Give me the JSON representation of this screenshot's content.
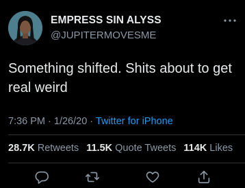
{
  "author": {
    "display_name": "EMPRESS SIN ALYSS",
    "handle": "@JUPITERMOVESME"
  },
  "tweet": {
    "text": "Something shifted. Shits about to get real weird"
  },
  "meta": {
    "time": "7:36 PM",
    "separator1": " · ",
    "date": "1/26/20",
    "separator2": " · ",
    "source": "Twitter for iPhone"
  },
  "stats": {
    "retweets_count": "28.7K",
    "retweets_label": "Retweets",
    "quotes_count": "11.5K",
    "quotes_label": "Quote Tweets",
    "likes_count": "114K",
    "likes_label": "Likes"
  },
  "icons": {
    "more": "more-horizontal-icon",
    "reply": "reply-icon",
    "retweet": "retweet-icon",
    "like": "heart-icon",
    "share": "share-icon"
  },
  "colors": {
    "background": "#000000",
    "text_primary": "#e7e9ea",
    "text_secondary": "#8b98a5",
    "link": "#1d9bf0",
    "divider": "#2f3336"
  }
}
